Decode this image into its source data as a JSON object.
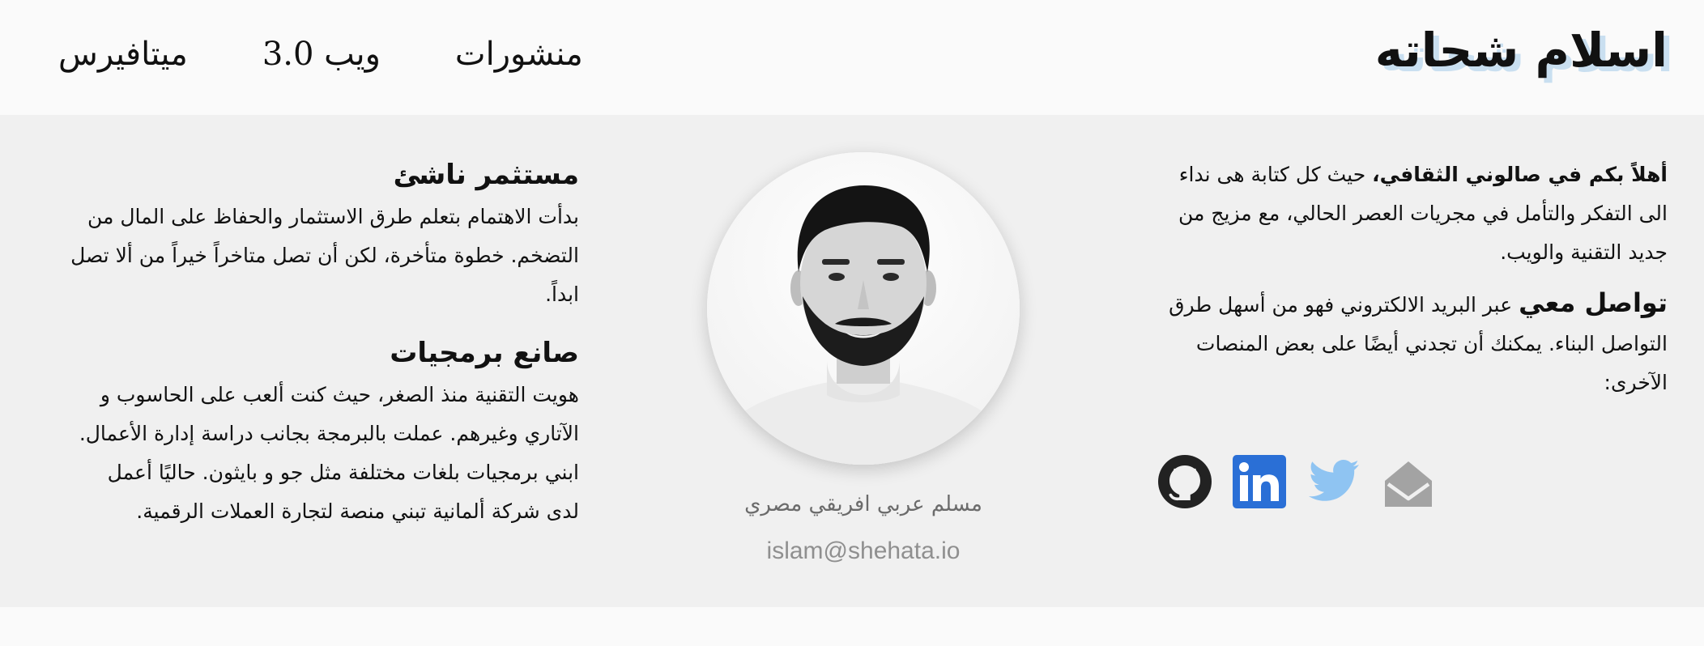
{
  "header": {
    "site_title": "اسلام شحاته",
    "nav": [
      {
        "label": "منشورات"
      },
      {
        "label": "ويب 3.0"
      },
      {
        "label": "ميتافيرس"
      }
    ]
  },
  "intro": {
    "welcome_strong": "أهلاً بكم في صالوني الثقافي،",
    "welcome_rest": " حيث كل كتابة هى نداء الى التفكر والتأمل في مجريات العصر الحالي، مع مزيج من جديد التقنية والويب.",
    "contact_strong": "تواصل معي",
    "contact_rest": " عبر البريد الالكتروني فهو من أسهل طرق التواصل البناء. يمكنك أن تجدني أيضًا على بعض المنصات الآخرى:"
  },
  "social": [
    {
      "icon": "github-icon",
      "color": "#222222"
    },
    {
      "icon": "linkedin-icon",
      "color": "#2a6fd6"
    },
    {
      "icon": "twitter-icon",
      "color": "#8fc4f2"
    },
    {
      "icon": "mail-icon",
      "color": "#a3a3a3"
    }
  ],
  "profile": {
    "tagline": "مسلم عربي افريقي مصري",
    "email": "islam@shehata.io"
  },
  "sections": [
    {
      "title": "مستثمر ناشئ",
      "body": "بدأت الاهتمام بتعلم طرق الاستثمار والحفاظ على المال من التضخم. خطوة متأخرة، لكن أن تصل متاخراً خيراً من ألا تصل ابداً."
    },
    {
      "title": "صانع برمجيات",
      "body": "هويت التقنية منذ الصغر، حيث كنت ألعب على الحاسوب و الآتاري وغيرهم. عملت بالبرمجة بجانب دراسة إدارة الأعمال. ابني برمجيات بلغات مختلفة مثل جو و بايثون. حاليًا أعمل لدى شركة ألمانية تبني منصة لتجارة العملات الرقمية."
    }
  ],
  "colors": {
    "title_shadow": "#c9dff0",
    "content_bg": "#f0f0f0",
    "page_bg": "#fafafa"
  }
}
